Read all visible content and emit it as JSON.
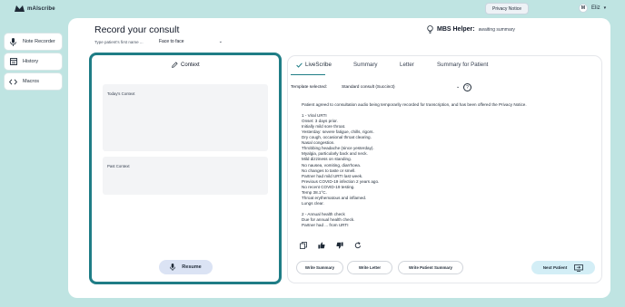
{
  "app": {
    "brand": "mAIscribe"
  },
  "header": {
    "privacy_button": "Privacy Notice",
    "user_initial": "M",
    "user_name": "Eliz"
  },
  "sidebar": {
    "items": [
      {
        "label": "Note Recorder",
        "icon": "microphone-icon"
      },
      {
        "label": "History",
        "icon": "calendar-icon"
      },
      {
        "label": "Macros",
        "icon": "code-icon"
      }
    ]
  },
  "main": {
    "title": "Record your consult",
    "patient_name_placeholder": "Type patient's first name ...",
    "consult_type": "Face to face",
    "mbs_label": "MBS Helper:",
    "mbs_status": "awaiting summary"
  },
  "context": {
    "title": "Context",
    "today_label": "Today's Context",
    "past_label": "Past Context",
    "resume_label": "Resume"
  },
  "live": {
    "tabs": [
      {
        "label": "LiveScribe"
      },
      {
        "label": "Summary"
      },
      {
        "label": "Letter"
      },
      {
        "label": "Summary for Patient"
      }
    ],
    "template_label": "Template selected:",
    "template_value": "Standard consult (Succinct)",
    "lines": [
      "Patient agreed to consultation audio being temporarily recorded for transcription, and has been offered the Privacy Notice.",
      "",
      "1 - Viral URTI",
      "Onset: 3 days prior.",
      "Initially mild sore throat.",
      "Yesterday: severe fatigue, chills, rigors.",
      "Dry cough, occasional throat clearing.",
      "Nasal congestion.",
      "Throbbing headache (since yesterday).",
      "Myalgia, particularly back and neck.",
      "Mild dizziness on standing.",
      "No nausea, vomiting, diarrhoea.",
      "No changes to taste or smell.",
      "Partner had mild URTI last week.",
      "Previous COVID-19 infection 2 years ago.",
      "No recent COVID-19 testing.",
      "Temp 38.1°C.",
      "Throat erythematous and inflamed.",
      "Lungs clear.",
      "",
      "2 - Annual health check",
      "Due for annual health check.",
      "Partner had ... from URTI"
    ],
    "buttons": {
      "write_summary": "Write Summary",
      "write_letter": "Write Letter",
      "write_patient_summary": "Write Patient Summary",
      "next_patient": "Next Patient"
    }
  },
  "colors": {
    "background": "#bfe4e2",
    "accent": "#1f7d86",
    "resume_bg": "#dbe3f4",
    "next_bg": "#d3eef6"
  }
}
